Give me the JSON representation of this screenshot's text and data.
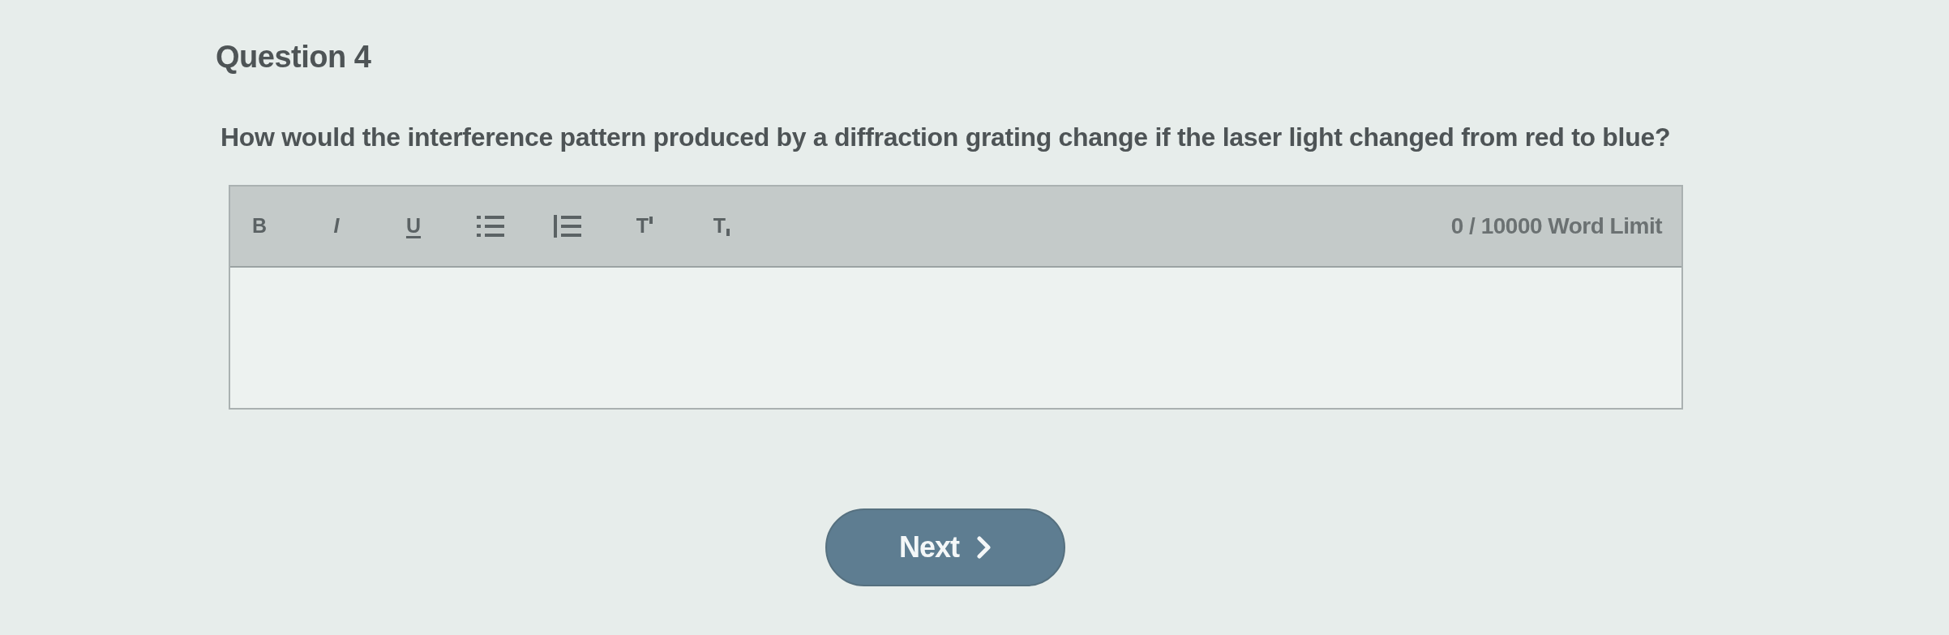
{
  "question": {
    "title": "Question 4",
    "text": "How would the interference pattern produced by a diffraction grating change if the laser light changed from red to blue?"
  },
  "editor": {
    "toolbar": [
      {
        "kind": "bold",
        "label": "B"
      },
      {
        "kind": "italic",
        "label": "I"
      },
      {
        "kind": "underline",
        "label": "U"
      },
      {
        "kind": "bullet-list"
      },
      {
        "kind": "numbered-list"
      },
      {
        "kind": "superscript",
        "label": "T"
      },
      {
        "kind": "subscript",
        "label": "T"
      }
    ],
    "word_count": "0 / 10000 Word Limit"
  },
  "next_button": {
    "label": "Next"
  }
}
